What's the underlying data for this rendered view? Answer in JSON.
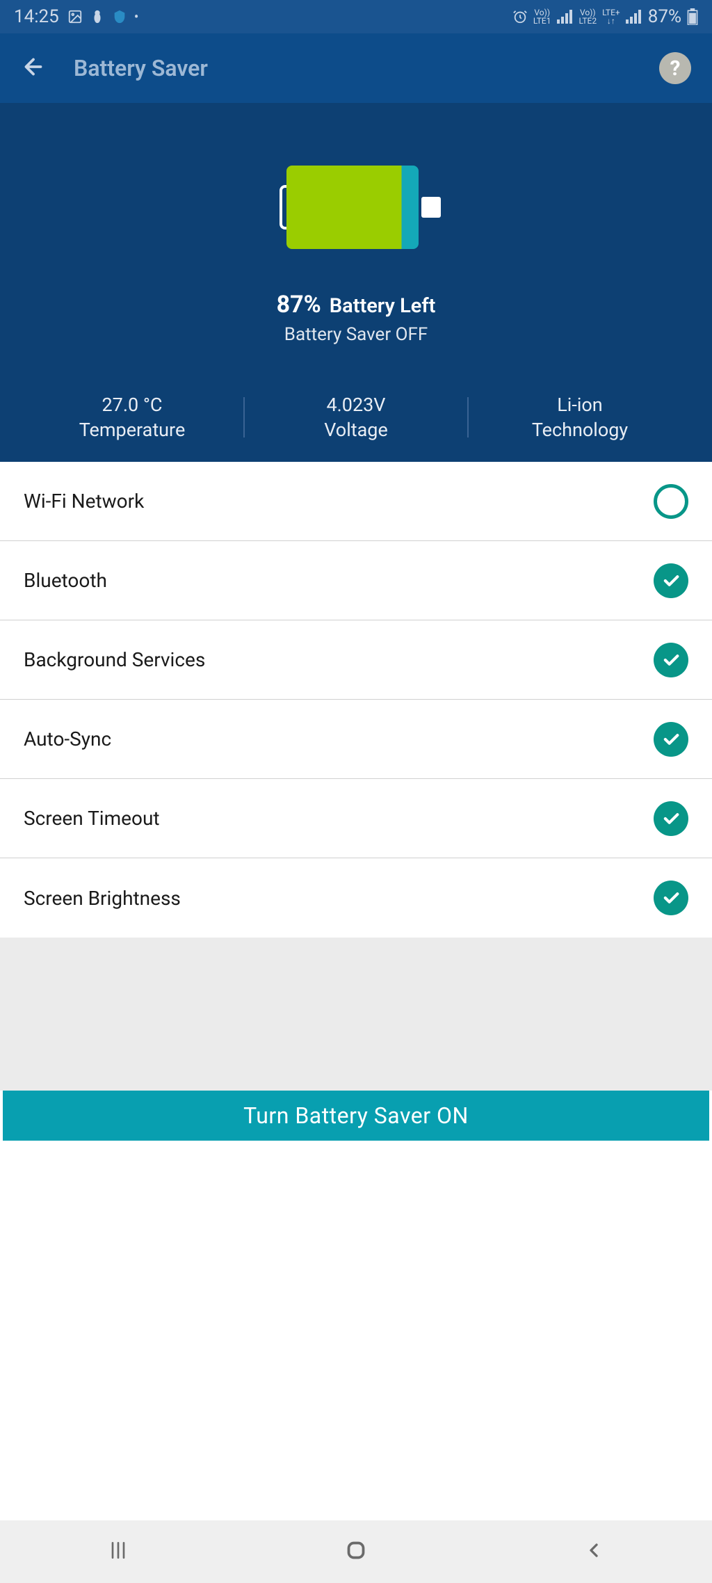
{
  "status_bar": {
    "time": "14:25",
    "sim1": "LTE1",
    "sim2": "LTE2",
    "net_prefix": "Vo))",
    "net_suffix": "LTE+",
    "battery": "87%"
  },
  "app_bar": {
    "title": "Battery Saver",
    "help": "?"
  },
  "hero": {
    "percent": "87%",
    "left_label": "Battery Left",
    "saver_status": "Battery Saver OFF",
    "stats": {
      "temp_value": "27.0 °C",
      "temp_label": "Temperature",
      "volt_value": "4.023V",
      "volt_label": "Voltage",
      "tech_value": "Li-ion",
      "tech_label": "Technology"
    }
  },
  "items": {
    "wifi": "Wi-Fi Network",
    "bluetooth": "Bluetooth",
    "bgservices": "Background Services",
    "autosync": "Auto-Sync",
    "timeout": "Screen Timeout",
    "brightness": "Screen Brightness"
  },
  "cta": "Turn Battery Saver ON"
}
